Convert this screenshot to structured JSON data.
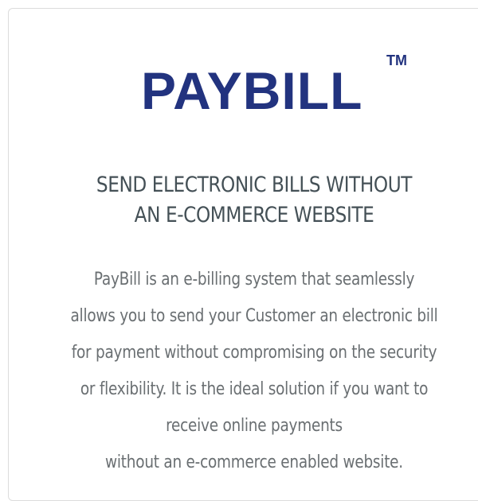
{
  "logo": {
    "text": "PAYBILL",
    "trademark": "TM",
    "color": "#22337f"
  },
  "headline": {
    "lines": [
      "SEND ELECTRONIC BILLS WITHOUT",
      "AN E-COMMERCE WEBSITE"
    ]
  },
  "description": {
    "lines": [
      "PayBill is an e-billing system that seamlessly",
      "allows you to send your Customer an electronic bill",
      "for payment without compromising on the security",
      "or flexibility. It is the ideal solution if you want to",
      "receive online payments",
      "without an e-commerce enabled website."
    ]
  }
}
